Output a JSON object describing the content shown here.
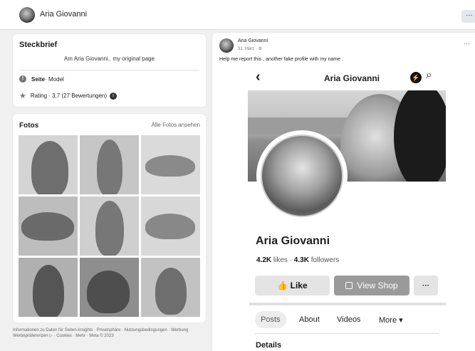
{
  "header": {
    "name": "Aria Giovanni",
    "more_label": "···"
  },
  "steckbrief": {
    "title": "Steckbrief",
    "intro": "Am Aria Giovanni.. my original page",
    "category_label": "Seite",
    "category_value": " · Model",
    "rating": "Rating · 3,7 (27 Bewertungen)",
    "info_badge": "i"
  },
  "fotos": {
    "title": "Fotos",
    "see_all": "Alle Fotos ansehen",
    "photo_count": 9
  },
  "footer": {
    "text": "Informationen zu Daten für Seiten-Insights · Privatsphäre · Nutzungsbedingungen · Werbung · Werbepräferenzen ▷ · Cookies · Mehr · Meta © 2023"
  },
  "post": {
    "author": "Aria Giovanni",
    "date": "31. März · ⚙",
    "more_label": "···",
    "text": "Help me report this , another fake profile with my name ."
  },
  "screenshot": {
    "back": "‹",
    "title": "Aria Giovanni",
    "page_name": "Aria Giovanni",
    "likes_value": "4.2K",
    "likes_label": " likes  ·  ",
    "followers_value": "4.3K",
    "followers_label": " followers",
    "like_button": "👍 Like",
    "shop_button": "View Shop",
    "more_button": "···",
    "tabs": [
      "Posts",
      "About",
      "Videos",
      "More ▾"
    ],
    "details": "Details"
  }
}
